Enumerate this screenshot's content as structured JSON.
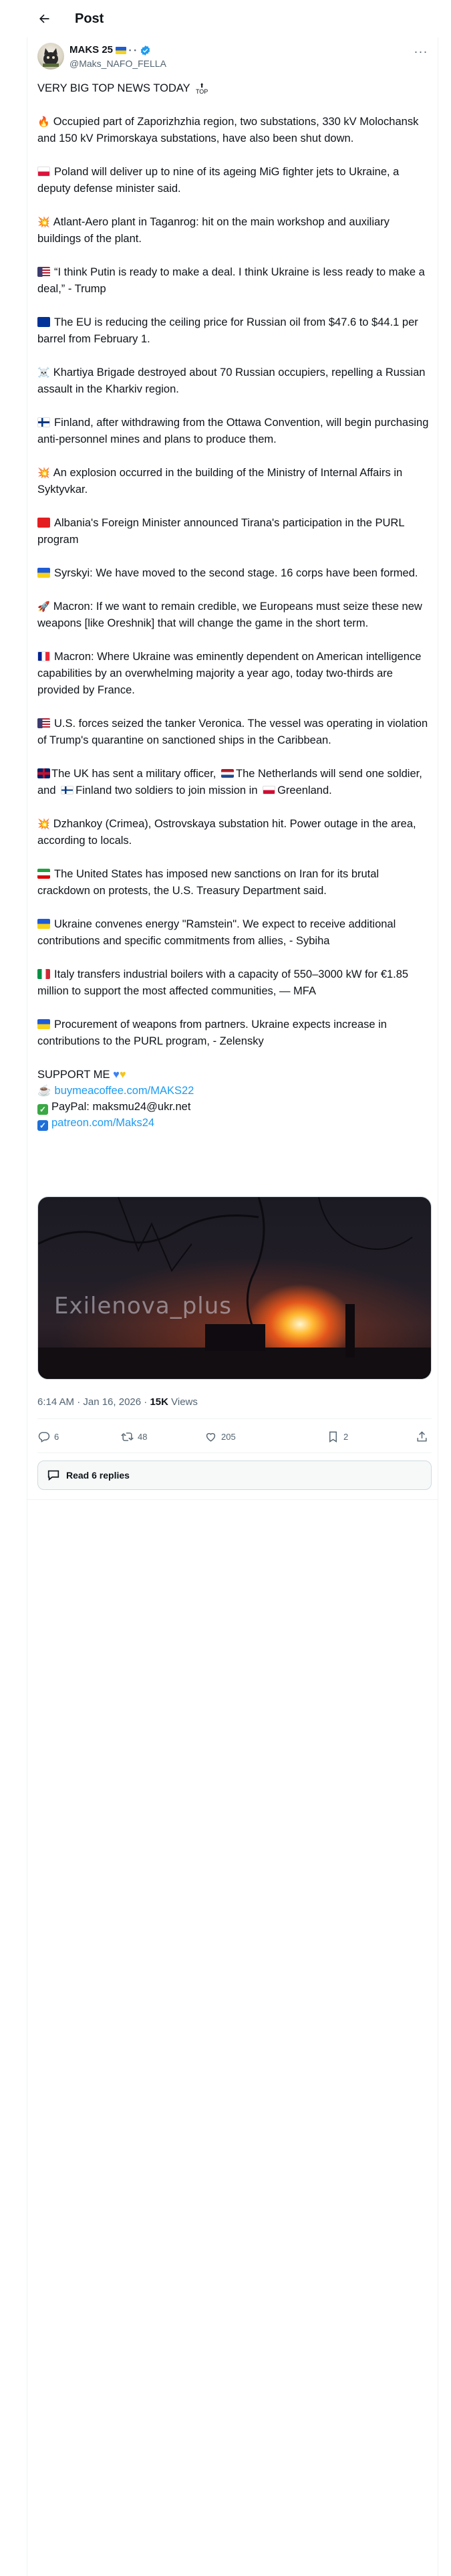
{
  "topbar": {
    "title": "Post"
  },
  "author": {
    "name": "MAKS 25",
    "handle": "@Maks_NAFO_FELLA",
    "name_suffix": "• •"
  },
  "post": {
    "headline": "VERY BIG TOP NEWS TODAY",
    "headline_icon": "TOP",
    "items": [
      {
        "icon": "fire",
        "text": "Occupied part of Zaporizhzhia region, two substations, 330 kV Molochansk and 150 kV Primorskaya substations, have also been shut down."
      },
      {
        "icon": "flag-pl",
        "text": "Poland will deliver up to nine of its ageing MiG fighter jets to Ukraine, a deputy defense minister said."
      },
      {
        "icon": "explosion",
        "text": "Atlant-Aero plant in Taganrog: hit on the main workshop and auxiliary buildings of the plant."
      },
      {
        "icon": "flag-us",
        "text": "“I think Putin is ready to make a deal. I think Ukraine is less ready to make a deal,” - Trump"
      },
      {
        "icon": "flag-eu",
        "text": "The EU is reducing the ceiling price for Russian oil from $47.6 to $44.1 per barrel from February 1."
      },
      {
        "icon": "skull",
        "text": "Khartiya Brigade destroyed about 70 Russian occupiers, repelling a Russian assault in the Kharkiv region."
      },
      {
        "icon": "flag-fi",
        "text": "Finland, after withdrawing from the Ottawa Convention, will begin purchasing anti-personnel mines and plans to produce them."
      },
      {
        "icon": "explosion",
        "text": "An explosion occurred in the building of the Ministry of Internal Affairs in Syktyvkar."
      },
      {
        "icon": "flag-al",
        "text": "Albania's Foreign Minister announced Tirana's participation in the PURL program"
      },
      {
        "icon": "flag-ua",
        "text": "Syrskyi: We have moved to the second stage. 16 corps have been formed."
      },
      {
        "icon": "rocket",
        "text": "Macron: If we want to remain credible, we Europeans must seize these new weapons [like Oreshnik] that will change the game in the short term."
      },
      {
        "icon": "flag-fr",
        "text": "Macron: Where Ukraine was eminently dependent on American intelligence capabilities by an overwhelming majority a year ago, today two-thirds are provided by France."
      },
      {
        "icon": "flag-us",
        "text": "U.S. forces seized the tanker Veronica. The vessel was operating in violation of Trump's quarantine on sanctioned ships in the Caribbean."
      },
      {
        "icon": "explosion",
        "text": "Dzhankoy (Crimea), Ostrovskaya substation hit. Power outage in the area, according to locals."
      },
      {
        "icon": "flag-ir",
        "text": "The United States has imposed new sanctions on Iran for its brutal crackdown on protests, the U.S. Treasury Department said."
      },
      {
        "icon": "flag-ua",
        "text": "Ukraine convenes energy \"Ramstein\". We expect to receive additional contributions and specific commitments from allies, - Sybiha"
      },
      {
        "icon": "flag-it",
        "text": "Italy transfers industrial boilers with a capacity of 550–3000 kW for €1.85 million to support the most affected communities, — MFA"
      },
      {
        "icon": "flag-ua",
        "text": "Procurement of weapons from partners. Ukraine expects increase in contributions to the PURL program, - Zelensky"
      }
    ],
    "uk_item": {
      "part1": "The UK has sent a military officer,",
      "part2": "The Netherlands will send one soldier, and",
      "part3": "Finland two soldiers to join mission in",
      "part4": "Greenland."
    },
    "support": {
      "title": "SUPPORT ME",
      "coffee_link": "buymeacoffee.com/MAKS22",
      "paypal": "PayPal: maksmu24@ukr.net",
      "patreon_link": "patreon.com/Maks24"
    },
    "media_watermark": "Exilenova_plus"
  },
  "meta": {
    "time": "6:14 AM · Jan 16, 2026 · ",
    "views_count": "15K",
    "views_label": " Views"
  },
  "actions": {
    "replies": "6",
    "reposts": "48",
    "likes": "205",
    "bookmarks": "2"
  },
  "read_replies": "Read 6 replies"
}
